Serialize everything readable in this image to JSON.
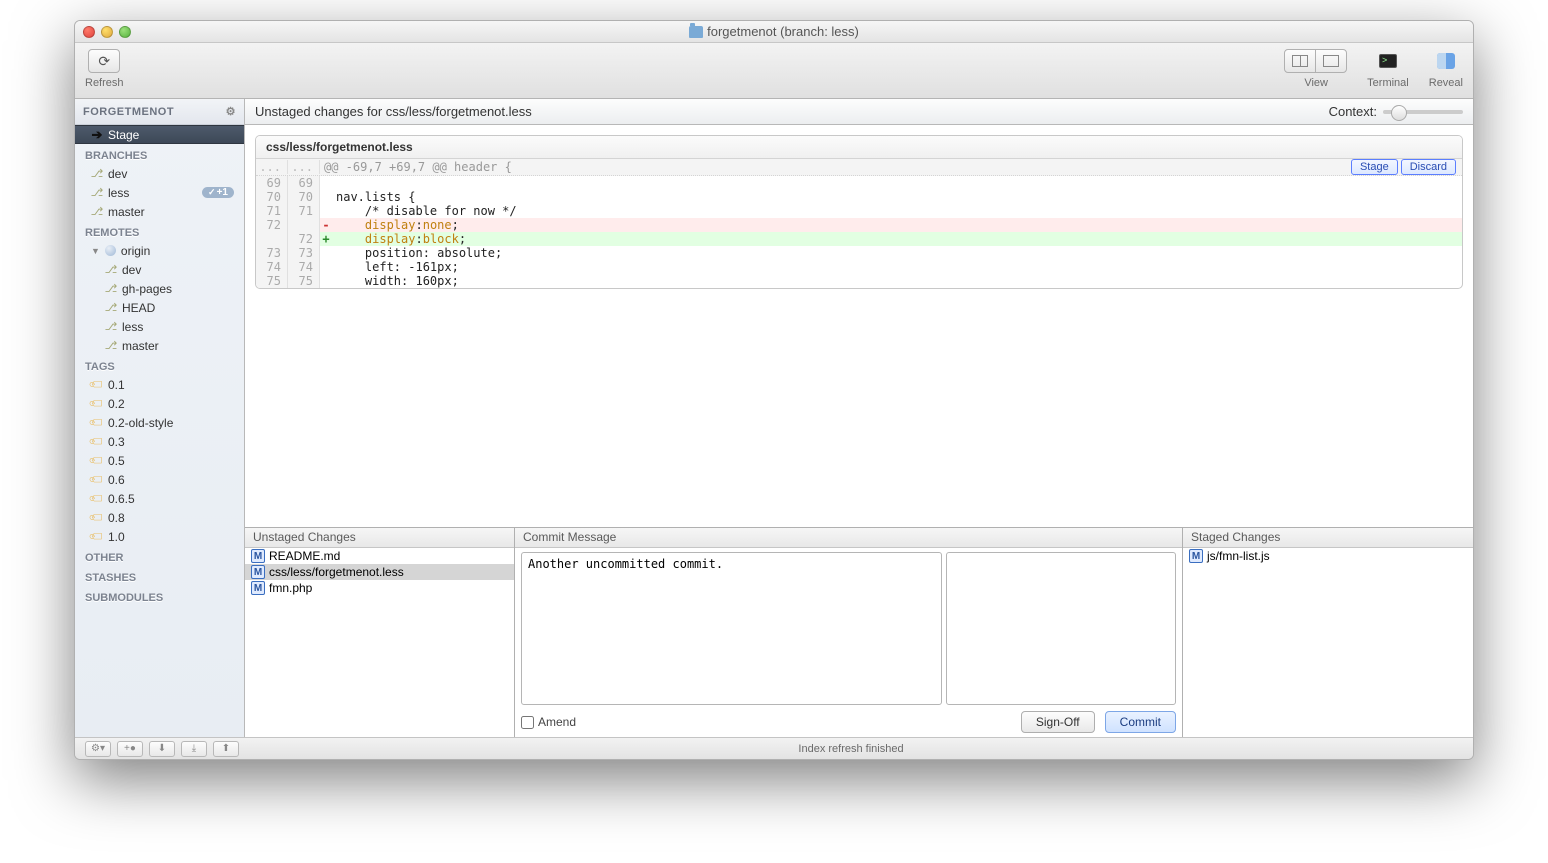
{
  "title": "forgetmenot (branch: less)",
  "toolbar": {
    "refresh": "Refresh",
    "view": "View",
    "terminal": "Terminal",
    "reveal": "Reveal"
  },
  "sidebar": {
    "repo": "FORGETMENOT",
    "stage": "Stage",
    "branches_title": "BRANCHES",
    "branches": [
      "dev",
      "less",
      "master"
    ],
    "current_branch": "less",
    "branch_badge": "+1",
    "remotes_title": "REMOTES",
    "remote_name": "origin",
    "remote_branches": [
      "dev",
      "gh-pages",
      "HEAD",
      "less",
      "master"
    ],
    "tags_title": "TAGS",
    "tags": [
      "0.1",
      "0.2",
      "0.2-old-style",
      "0.3",
      "0.5",
      "0.6",
      "0.6.5",
      "0.8",
      "1.0"
    ],
    "other": "OTHER",
    "stashes": "STASHES",
    "submodules": "SUBMODULES"
  },
  "fileheader": "Unstaged changes for css/less/forgetmenot.less",
  "context_label": "Context:",
  "diff": {
    "file": "css/less/forgetmenot.less",
    "hunk": "@@ -69,7 +69,7 @@ header {",
    "stage_btn": "Stage",
    "discard_btn": "Discard",
    "lines": [
      {
        "ol": "69",
        "nl": "69",
        "t": "ctx",
        "code": ""
      },
      {
        "ol": "70",
        "nl": "70",
        "t": "ctx",
        "code": "nav.lists {"
      },
      {
        "ol": "71",
        "nl": "71",
        "t": "ctx",
        "code": "    /* disable for now */"
      },
      {
        "ol": "72",
        "nl": "",
        "t": "del",
        "code": "    display:none;"
      },
      {
        "ol": "",
        "nl": "72",
        "t": "add",
        "code": "    display:block;"
      },
      {
        "ol": "73",
        "nl": "73",
        "t": "ctx",
        "code": "    position: absolute;"
      },
      {
        "ol": "74",
        "nl": "74",
        "t": "ctx",
        "code": "    left: -161px;"
      },
      {
        "ol": "75",
        "nl": "75",
        "t": "ctx",
        "code": "    width: 160px;"
      }
    ]
  },
  "panels": {
    "unstaged_title": "Unstaged Changes",
    "unstaged": [
      "README.md",
      "css/less/forgetmenot.less",
      "fmn.php"
    ],
    "unstaged_selected": "css/less/forgetmenot.less",
    "commit_title": "Commit Message",
    "commit_msg": "Another uncommitted commit.",
    "staged_title": "Staged Changes",
    "staged": [
      "js/fmn-list.js"
    ]
  },
  "commit": {
    "amend": "Amend",
    "signoff": "Sign-Off",
    "commit": "Commit"
  },
  "status": "Index refresh finished"
}
